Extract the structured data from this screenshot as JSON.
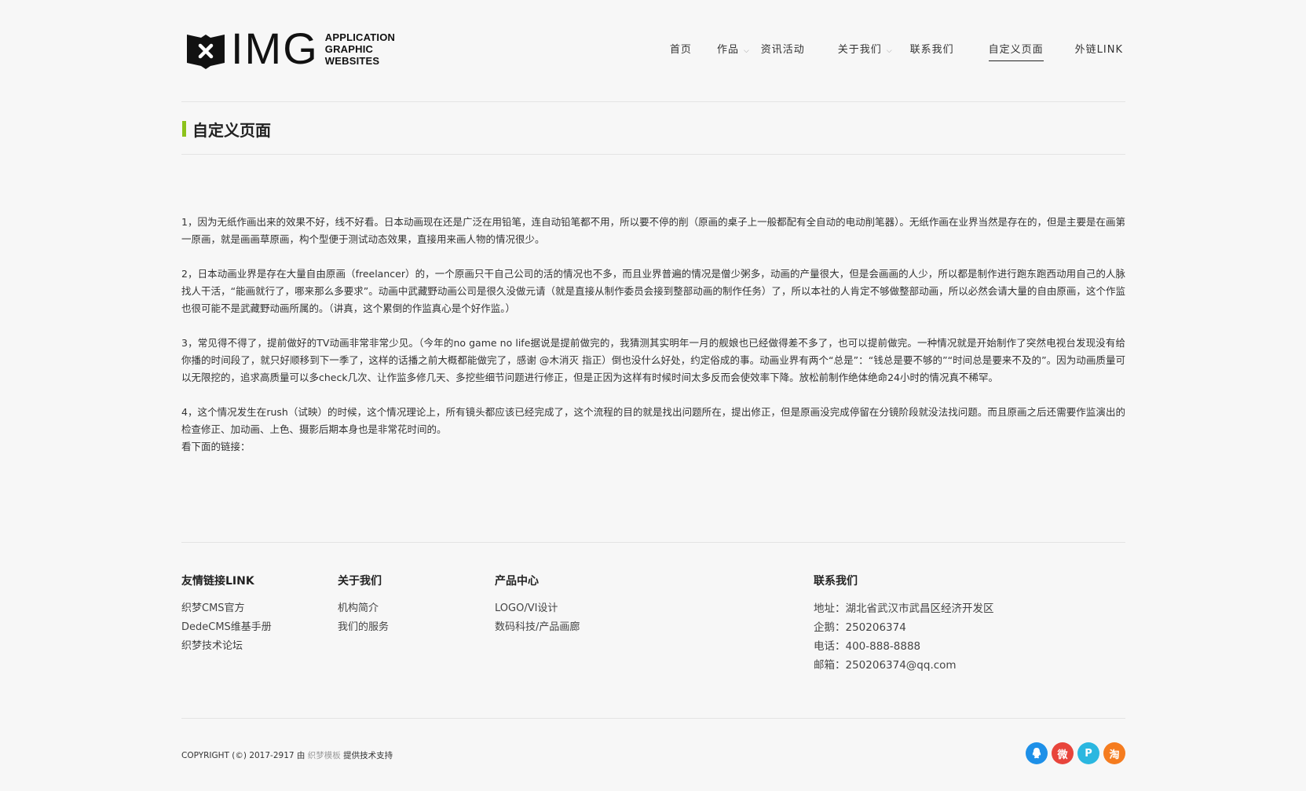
{
  "logo": {
    "text": "IMG",
    "sub_line1": "APPLICATION",
    "sub_line2": "GRAPHIC",
    "sub_line3": "WEBSITES"
  },
  "nav": {
    "items": [
      {
        "label": "首页"
      },
      {
        "label": "作品"
      },
      {
        "label": "资讯活动"
      },
      {
        "label": "关于我们"
      },
      {
        "label": "联系我们"
      },
      {
        "label": "自定义页面"
      },
      {
        "label": "外链LINK"
      }
    ]
  },
  "page": {
    "title": "自定义页面",
    "accent_color": "#8cc21c"
  },
  "article": {
    "p1": "1，因为无纸作画出来的效果不好，线不好看。日本动画现在还是广泛在用铅笔，连自动铅笔都不用，所以要不停的削（原画的桌子上一般都配有全自动的电动削笔器）。无纸作画在业界当然是存在的，但是主要是在画第一原画，就是画画草原画，构个型便于测试动态效果，直接用来画人物的情况很少。",
    "p2": "2，日本动画业界是存在大量自由原画（freelancer）的，一个原画只干自己公司的活的情况也不多，而且业界普遍的情况是僧少粥多，动画的产量很大，但是会画画的人少，所以都是制作进行跑东跑西动用自己的人脉找人干活，“能画就行了，哪来那么多要求”。动画中武藏野动画公司是很久没做元请（就是直接从制作委员会接到整部动画的制作任务）了，所以本社的人肯定不够做整部动画，所以必然会请大量的自由原画，这个作监也很可能不是武藏野动画所属的。（讲真，这个累倒的作监真心是个好作监。）",
    "p3": "3，常见得不得了，提前做好的TV动画非常非常少见。（今年的no game no life据说是提前做完的，我猜测其实明年一月的舰娘也已经做得差不多了，也可以提前做完。一种情况就是开始制作了突然电视台发现没有给你播的时间段了，就只好顺移到下一季了，这样的话播之前大概都能做完了，感谢 @木消灭 指正）倒也没什么好处，约定俗成的事。动画业界有两个“总是”：“钱总是要不够的”“时间总是要来不及的”。因为动画质量可以无限挖的，追求高质量可以多check几次、让作监多修几天、多挖些细节问题进行修正，但是正因为这样有时候时间太多反而会使效率下降。放松前制作绝体绝命24小时的情况真不稀罕。",
    "p4": "4，这个情况发生在rush（试映）的时候，这个情况理论上，所有镜头都应该已经完成了，这个流程的目的就是找出问题所在，提出修正，但是原画没完成停留在分镜阶段就没法找问题。而且原画之后还需要作监演出的检查修正、加动画、上色、摄影后期本身也是非常花时间的。",
    "p5": "看下面的链接："
  },
  "footer": {
    "links": {
      "heading": "友情链接LINK",
      "items": [
        "织梦CMS官方",
        "DedeCMS维基手册",
        "织梦技术论坛"
      ]
    },
    "about": {
      "heading": "关于我们",
      "items": [
        "机构简介",
        "我们的服务"
      ]
    },
    "products": {
      "heading": "产品中心",
      "items": [
        "LOGO/VI设计",
        "数码科技/产品画廊"
      ]
    },
    "contact": {
      "heading": "联系我们",
      "address": "地址：湖北省武汉市武昌区经济开发区",
      "qq": "企鹅：250206374",
      "phone": "电话：400-888-8888",
      "email": "邮箱：250206374@qq.com"
    }
  },
  "bottom": {
    "copyright_prefix": "COPYRIGHT (©) 2017-2917 由 ",
    "cms_name": "织梦模板",
    "copyright_suffix": " 提供技术支持"
  },
  "social": {
    "qq": {
      "icon": "qq-icon",
      "color": "#1e90e8"
    },
    "weibo": {
      "icon": "weibo-icon",
      "color": "#e8453c",
      "glyph": "微"
    },
    "pinterest": {
      "icon": "p-icon",
      "color": "#2bb7e0",
      "glyph": "P"
    },
    "taobao": {
      "icon": "taobao-icon",
      "color": "#f57c1f",
      "glyph": "淘"
    }
  }
}
